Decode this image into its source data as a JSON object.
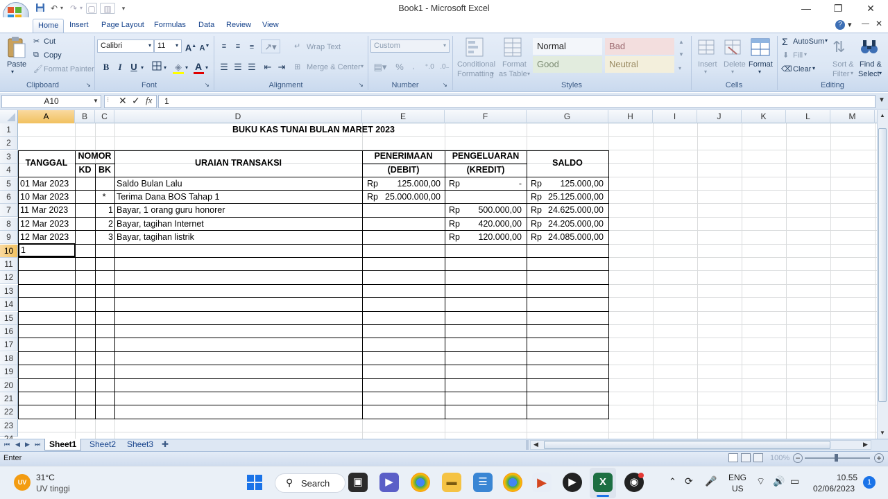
{
  "window": {
    "title": "Book1 - Microsoft Excel",
    "minimize": "—",
    "restore": "❐",
    "close": "✕"
  },
  "quick_access": [
    "save-icon",
    "undo-icon",
    "redo-icon"
  ],
  "ribbon": {
    "tabs": [
      "Home",
      "Insert",
      "Page Layout",
      "Formulas",
      "Data",
      "Review",
      "View"
    ],
    "active_tab": "Home",
    "clipboard": {
      "paste": "Paste",
      "cut": "Cut",
      "copy": "Copy",
      "format_painter": "Format Painter",
      "label": "Clipboard"
    },
    "font": {
      "name": "Calibri",
      "size": "11",
      "bold": "B",
      "italic": "I",
      "underline": "U",
      "label": "Font"
    },
    "alignment": {
      "wrap_text": "Wrap Text",
      "merge_center": "Merge & Center",
      "label": "Alignment"
    },
    "number": {
      "format": "Custom",
      "label": "Number"
    },
    "styles": {
      "conditional": [
        "Conditional",
        "Formatting"
      ],
      "format_table": [
        "Format",
        "as Table"
      ],
      "cells": [
        {
          "name": "Normal",
          "bg": "#ffffff",
          "fg": "#1e1e1e"
        },
        {
          "name": "Bad",
          "bg": "#ffc7ce",
          "fg": "#9c0006"
        },
        {
          "name": "Good",
          "bg": "#c6efce",
          "fg": "#006100"
        },
        {
          "name": "Neutral",
          "bg": "#ffeb9c",
          "fg": "#9c6500"
        }
      ],
      "label": "Styles"
    },
    "cells": {
      "insert": "Insert",
      "delete": "Delete",
      "format": "Format",
      "label": "Cells"
    },
    "editing": {
      "autosum": "AutoSum",
      "fill": "Fill",
      "clear": "Clear",
      "sort_filter": [
        "Sort &",
        "Filter"
      ],
      "find_select": [
        "Find &",
        "Select"
      ],
      "label": "Editing"
    }
  },
  "formula_bar": {
    "name_box": "A10",
    "fx": "fx",
    "value": "1"
  },
  "columns": [
    "A",
    "B",
    "C",
    "D",
    "E",
    "F",
    "G",
    "H",
    "I",
    "J",
    "K",
    "L",
    "M"
  ],
  "rows": [
    "1",
    "2",
    "3",
    "4",
    "5",
    "6",
    "7",
    "8",
    "9",
    "10",
    "11",
    "12",
    "13",
    "14",
    "15",
    "16",
    "17",
    "18",
    "19",
    "20",
    "21",
    "22",
    "23",
    "24"
  ],
  "sheet": {
    "title": "BUKU KAS TUNAI BULAN MARET 2023",
    "headers": {
      "tanggal": "TANGGAL",
      "nomor": "NOMOR",
      "kd": "KD",
      "bk": "BK",
      "uraian": "URAIAN TRANSAKSI",
      "penerimaan": "PENERIMAAN",
      "debit": "(DEBIT)",
      "pengeluaran": "PENGELUARAN",
      "kredit": "(KREDIT)",
      "saldo": "SALDO"
    },
    "transactions": [
      {
        "tanggal": "01 Mar 2023",
        "kd": "",
        "bk": "",
        "uraian": "Saldo Bulan Lalu",
        "debit_cur": "Rp",
        "debit": "125.000,00",
        "kredit_cur": "Rp",
        "kredit": "-",
        "saldo_cur": "Rp",
        "saldo": "125.000,00"
      },
      {
        "tanggal": "10 Mar 2023",
        "kd": "",
        "bk": "*",
        "uraian": "Terima Dana BOS Tahap 1",
        "debit_cur": "Rp",
        "debit": "25.000.000,00",
        "kredit_cur": "",
        "kredit": "",
        "saldo_cur": "Rp",
        "saldo": "25.125.000,00"
      },
      {
        "tanggal": "11 Mar 2023",
        "kd": "",
        "bk": "1",
        "uraian": "Bayar, 1 orang guru honorer",
        "debit_cur": "",
        "debit": "",
        "kredit_cur": "Rp",
        "kredit": "500.000,00",
        "saldo_cur": "Rp",
        "saldo": "24.625.000,00"
      },
      {
        "tanggal": "12 Mar 2023",
        "kd": "",
        "bk": "2",
        "uraian": "Bayar, tagihan Internet",
        "debit_cur": "",
        "debit": "",
        "kredit_cur": "Rp",
        "kredit": "420.000,00",
        "saldo_cur": "Rp",
        "saldo": "24.205.000,00"
      },
      {
        "tanggal": "12 Mar 2023",
        "kd": "",
        "bk": "3",
        "uraian": "Bayar, tagihan listrik",
        "debit_cur": "",
        "debit": "",
        "kredit_cur": "Rp",
        "kredit": "120.000,00",
        "saldo_cur": "Rp",
        "saldo": "24.085.000,00"
      }
    ],
    "active_cell_value": "1"
  },
  "sheet_tabs": [
    "Sheet1",
    "Sheet2",
    "Sheet3"
  ],
  "status": {
    "mode": "Enter",
    "zoom": "100%"
  },
  "taskbar": {
    "weather_temp": "31°C",
    "weather_desc": "UV tinggi",
    "weather_badge": "UV",
    "search": "Search",
    "lang": "ENG",
    "region": "US",
    "time": "10.55",
    "date": "02/06/2023",
    "notifications": "1"
  }
}
